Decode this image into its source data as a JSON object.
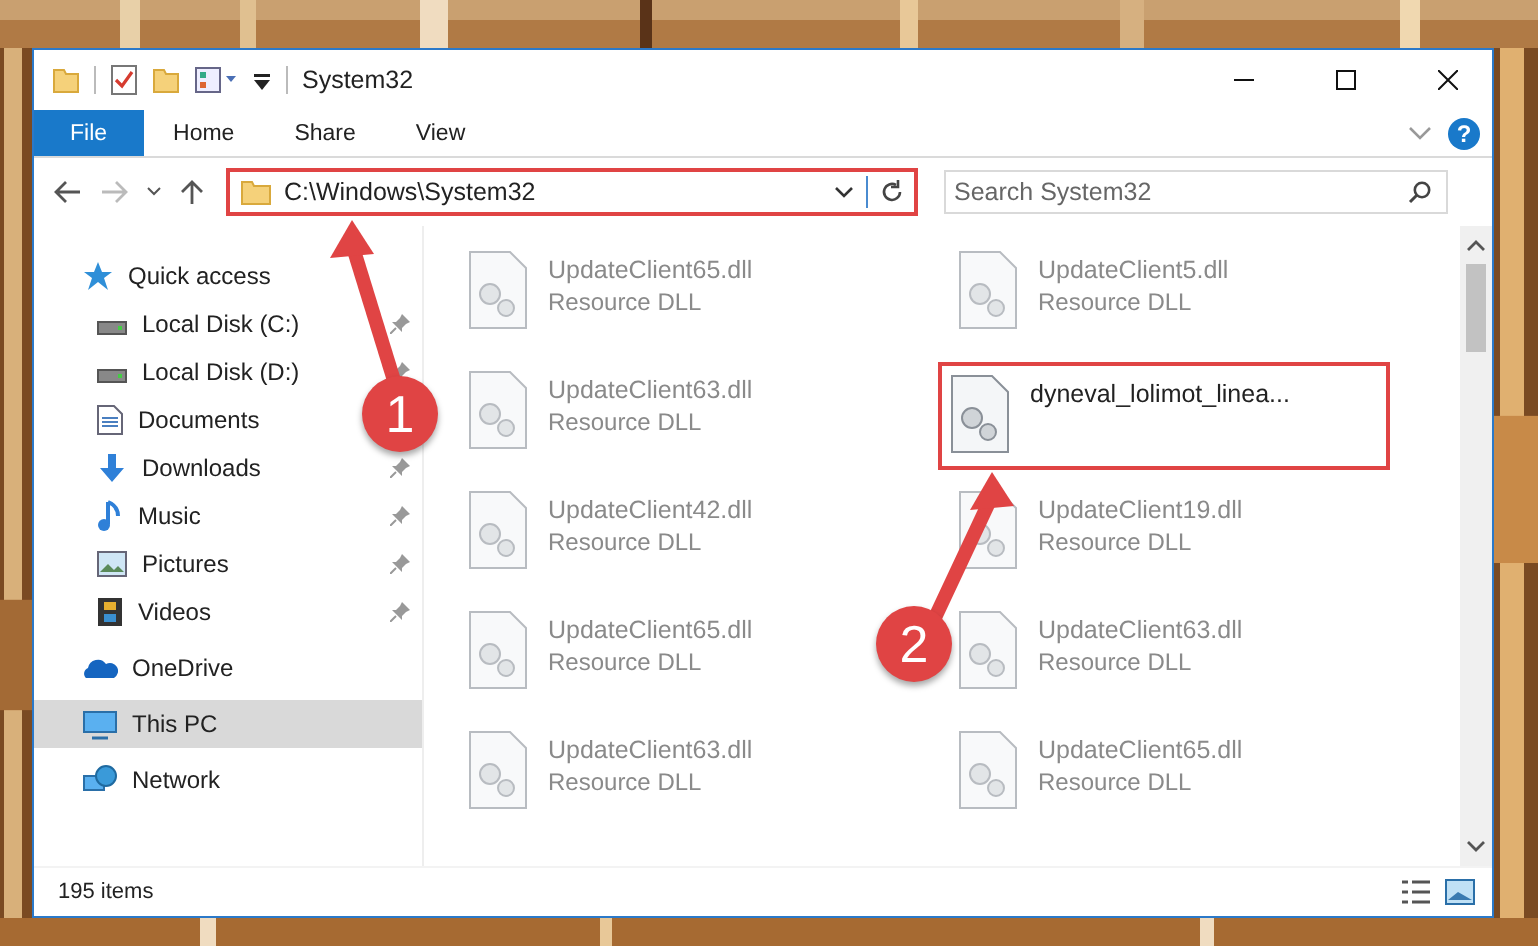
{
  "window": {
    "title": "System32"
  },
  "ribbon": {
    "tabs": [
      {
        "label": "File",
        "selected": true
      },
      {
        "label": "Home",
        "selected": false
      },
      {
        "label": "Share",
        "selected": false
      },
      {
        "label": "View",
        "selected": false
      }
    ],
    "help": "?"
  },
  "address": {
    "path": "C:\\Windows\\System32",
    "highlighted": true
  },
  "search": {
    "placeholder": "Search System32"
  },
  "sidebar": {
    "items": [
      {
        "label": "Quick access",
        "kind": "quick",
        "selected": false,
        "children": [
          {
            "label": "Local Disk (C:)",
            "kind": "drive",
            "pinned": true
          },
          {
            "label": "Local Disk (D:)",
            "kind": "drive",
            "pinned": true
          },
          {
            "label": "Documents",
            "kind": "documents"
          },
          {
            "label": "Downloads",
            "kind": "downloads",
            "pinned": true
          },
          {
            "label": "Music",
            "kind": "music",
            "pinned": true
          },
          {
            "label": "Pictures",
            "kind": "pictures",
            "pinned": true
          },
          {
            "label": "Videos",
            "kind": "videos",
            "pinned": true
          }
        ]
      },
      {
        "label": "OneDrive",
        "kind": "cloud",
        "selected": false
      },
      {
        "label": "This PC",
        "kind": "pc",
        "selected": true
      },
      {
        "label": "Network",
        "kind": "network",
        "selected": false
      }
    ]
  },
  "files": [
    {
      "name": "UpdateClient65.dll",
      "type": "Resource DLL",
      "blurred": true,
      "highlighted": false
    },
    {
      "name": "UpdateClient5.dll",
      "type": "Resource DLL",
      "blurred": true,
      "highlighted": false
    },
    {
      "name": "UpdateClient63.dll",
      "type": "Resource DLL",
      "blurred": true,
      "highlighted": false
    },
    {
      "name": "dyneval_lolimot_linea...",
      "blurred": false,
      "highlighted": true
    },
    {
      "name": "UpdateClient42.dll",
      "type": "Resource DLL",
      "blurred": true,
      "highlighted": false
    },
    {
      "name": "UpdateClient19.dll",
      "type": "Resource DLL",
      "blurred": true,
      "highlighted": false
    },
    {
      "name": "UpdateClient65.dll",
      "type": "Resource DLL",
      "blurred": true,
      "highlighted": false
    },
    {
      "name": "UpdateClient63.dll",
      "type": "Resource DLL",
      "blurred": true,
      "highlighted": false
    },
    {
      "name": "UpdateClient63.dll",
      "type": "Resource DLL",
      "blurred": true,
      "highlighted": false
    },
    {
      "name": "UpdateClient65.dll",
      "type": "Resource DLL",
      "blurred": true,
      "highlighted": false
    }
  ],
  "status_bar": {
    "count": "195 items"
  },
  "annotations": [
    {
      "label": "1"
    },
    {
      "label": "2"
    }
  ]
}
